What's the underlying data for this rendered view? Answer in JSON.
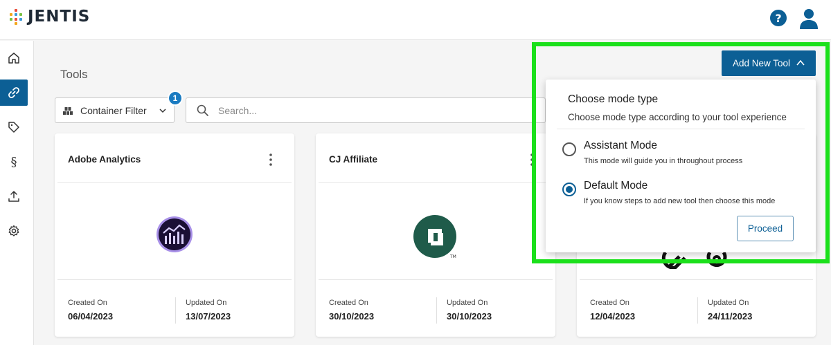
{
  "header": {
    "logo_text": "JENTIS",
    "help_label": "?"
  },
  "page": {
    "title": "Tools"
  },
  "filters": {
    "container_filter_label": "Container Filter",
    "container_filter_badge": "1",
    "search_placeholder": "Search..."
  },
  "toolbar": {
    "add_tool_label": "Add New Tool"
  },
  "mode_panel": {
    "title": "Choose mode type",
    "subtitle": "Choose mode type according to your tool experience",
    "options": [
      {
        "label": "Assistant Mode",
        "description": "This mode will guide you in throughout process",
        "selected": false
      },
      {
        "label": "Default Mode",
        "description": "If you know steps to add new tool then choose this mode",
        "selected": true
      }
    ],
    "proceed_label": "Proceed"
  },
  "cards": [
    {
      "title": "Adobe Analytics",
      "created_label": "Created On",
      "created": "06/04/2023",
      "updated_label": "Updated On",
      "updated": "13/07/2023"
    },
    {
      "title": "CJ Affiliate",
      "created_label": "Created On",
      "created": "30/10/2023",
      "updated_label": "Updated On",
      "updated": "30/10/2023"
    },
    {
      "title": "",
      "created_label": "Created On",
      "created": "12/04/2023",
      "updated_label": "Updated On",
      "updated": "24/11/2023"
    }
  ],
  "colors": {
    "primary": "#0c5f95",
    "badge": "#1a7bc1",
    "highlight": "#1be01b"
  }
}
